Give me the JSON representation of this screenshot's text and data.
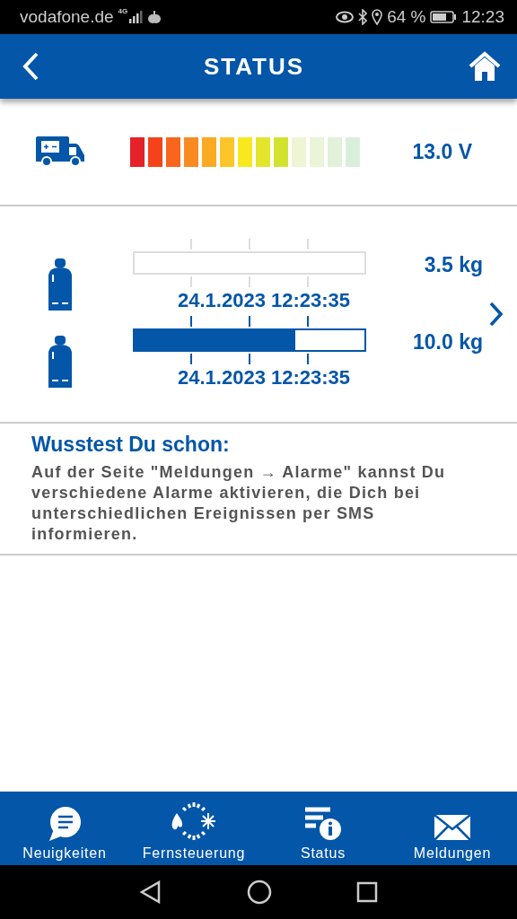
{
  "status_bar": {
    "carrier": "vodafone.de",
    "network": "4G",
    "battery_percent": "64 %",
    "time": "12:23"
  },
  "header": {
    "title": "STATUS"
  },
  "battery": {
    "reading": "13.0 V",
    "segments": [
      {
        "color": "#e52229"
      },
      {
        "color": "#f5421a"
      },
      {
        "color": "#f7661c"
      },
      {
        "color": "#f98a22"
      },
      {
        "color": "#fbaa24"
      },
      {
        "color": "#fcc52a"
      },
      {
        "color": "#f9e71f"
      },
      {
        "color": "#e5e42c"
      },
      {
        "color": "#d3e22f"
      },
      {
        "color": "#eef5d5"
      },
      {
        "color": "#e9f4d8"
      },
      {
        "color": "#e1f1da"
      },
      {
        "color": "#d8efdc"
      }
    ]
  },
  "gas_bottles": [
    {
      "disabled": true,
      "reading": "3.5 kg",
      "timestamp": "24.1.2023 12:23:35"
    },
    {
      "level": 0.7,
      "disabled": false,
      "reading": "10.0 kg",
      "timestamp": "24.1.2023 12:23:35"
    }
  ],
  "tip": {
    "title": "Wusstest Du schon:",
    "text": "Auf der Seite \"Meldungen → Alarme\" kannst Du verschiedene Alarme aktivieren, die Dich bei unterschiedlichen Ereignissen per SMS informieren."
  },
  "bottom_nav": [
    {
      "kind": "news",
      "label": "Neuigkeiten"
    },
    {
      "kind": "remote",
      "label": "Fernsteuerung"
    },
    {
      "kind": "status",
      "label": "Status"
    },
    {
      "kind": "messages",
      "label": "Meldungen"
    }
  ]
}
